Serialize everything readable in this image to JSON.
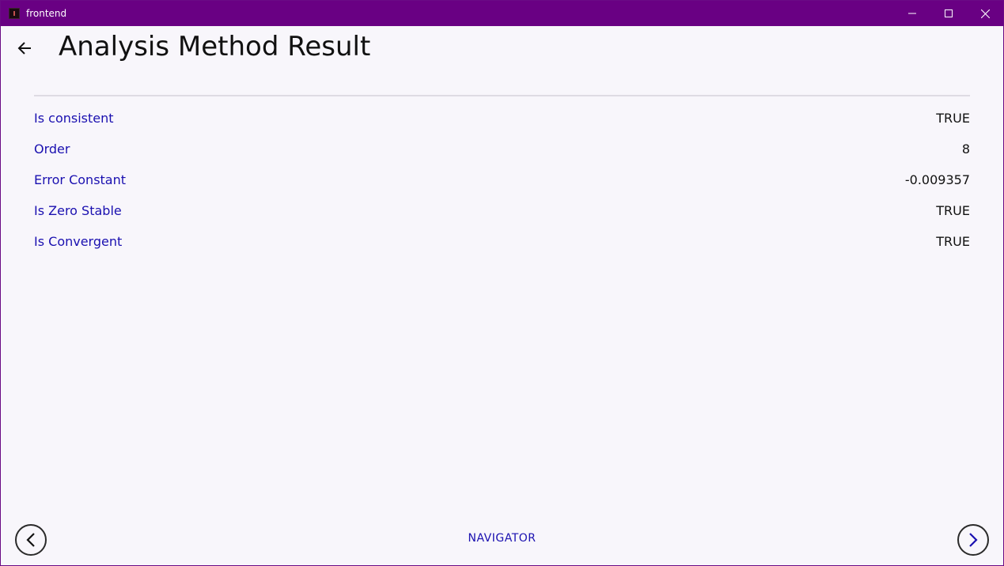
{
  "window": {
    "title": "frontend",
    "icon": "app-icon",
    "controls": {
      "minimize_icon": "minimize-icon",
      "maximize_icon": "maximize-icon",
      "close_icon": "close-icon"
    },
    "titlebar_color": "#690083"
  },
  "header": {
    "back_icon": "arrow-left-icon",
    "title": "Analysis Method Result"
  },
  "results": [
    {
      "label": "Is consistent",
      "value": "TRUE"
    },
    {
      "label": "Order",
      "value": "8"
    },
    {
      "label": "Error Constant",
      "value": "-0.009357"
    },
    {
      "label": "Is Zero Stable",
      "value": "TRUE"
    },
    {
      "label": "Is Convergent",
      "value": "TRUE"
    }
  ],
  "navigator": {
    "label": "NAVIGATOR",
    "prev_icon": "chevron-left-icon",
    "next_icon": "chevron-right-icon"
  },
  "colors": {
    "label_text": "#1a10b0",
    "value_text": "#111111",
    "background": "#f8f6fb"
  }
}
